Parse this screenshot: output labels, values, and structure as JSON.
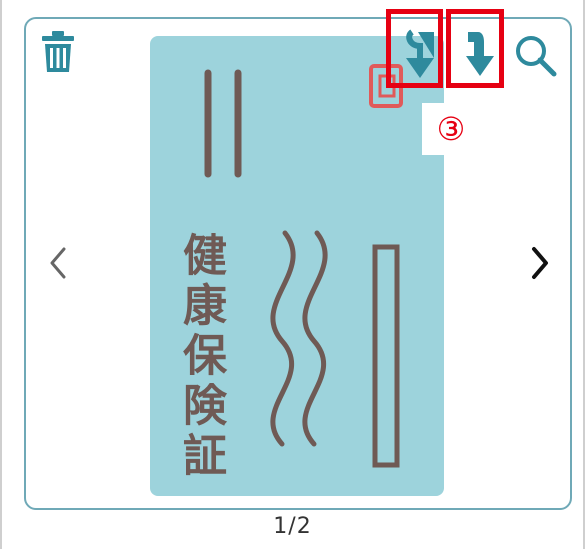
{
  "viewer": {
    "card_title": "健康保険証",
    "page_indicator": "1/2",
    "step_marker": "③"
  },
  "toolbar": {
    "delete_icon": "trash-icon",
    "rotate_left_icon": "rotate-left-icon",
    "rotate_right_icon": "rotate-right-icon",
    "zoom_icon": "search-icon"
  },
  "navigation": {
    "prev_icon": "chevron-left-icon",
    "next_icon": "chevron-right-icon"
  },
  "colors": {
    "accent": "#2e8a9d",
    "card": "#9dd3dc",
    "card_ink": "#6f5a55",
    "highlight": "#e60012"
  }
}
